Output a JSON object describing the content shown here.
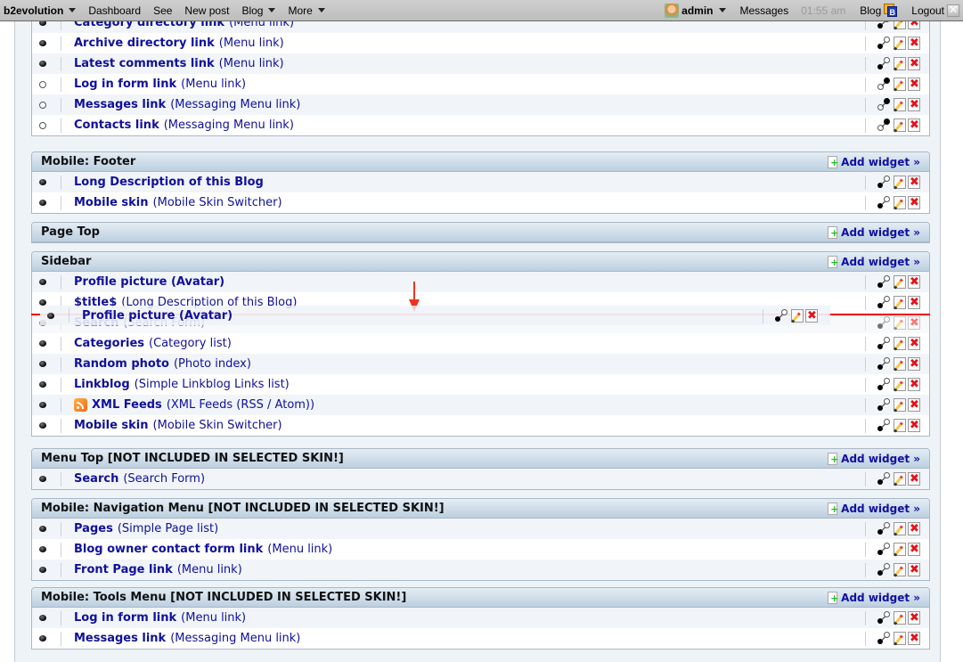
{
  "toolbar": {
    "brand": "b2evolution",
    "left_items": [
      "Dashboard",
      "See",
      "New post",
      "Blog",
      "More"
    ],
    "user": "admin",
    "messages": "Messages",
    "time": "01:55 am",
    "blog": "Blog",
    "logout": "Logout"
  },
  "add_widget_label": "Add widget »",
  "containers": [
    {
      "title": null,
      "rows": [
        {
          "name": "Category directory link",
          "type": "(Menu link)",
          "enabled": true
        },
        {
          "name": "Archive directory link",
          "type": "(Menu link)",
          "enabled": true
        },
        {
          "name": "Latest comments link",
          "type": "(Menu link)",
          "enabled": true
        },
        {
          "name": "Log in form link",
          "type": "(Menu link)",
          "enabled": false
        },
        {
          "name": "Messages link",
          "type": "(Messaging Menu link)",
          "enabled": false
        },
        {
          "name": "Contacts link",
          "type": "(Messaging Menu link)",
          "enabled": false
        }
      ]
    },
    {
      "title": "Mobile: Footer",
      "rows": [
        {
          "name": "Long Description of this Blog",
          "type": "",
          "enabled": true
        },
        {
          "name": "Mobile skin",
          "type": "(Mobile Skin Switcher)",
          "enabled": true
        }
      ]
    },
    {
      "title": "Page Top",
      "rows": []
    },
    {
      "title": "Sidebar",
      "rows": [
        {
          "name": "Profile picture (Avatar)",
          "type": "",
          "enabled": true
        },
        {
          "name": "$title$",
          "type": "(Long Description of this Blog)",
          "enabled": true
        },
        {
          "name": "Search",
          "type": "(Search Form)",
          "enabled": true
        },
        {
          "name": "Categories",
          "type": "(Category list)",
          "enabled": true
        },
        {
          "name": "Random photo",
          "type": "(Photo index)",
          "enabled": true
        },
        {
          "name": "Linkblog",
          "type": "(Simple Linkblog Links list)",
          "enabled": true
        },
        {
          "name": "XML Feeds",
          "type": "(XML Feeds (RSS / Atom))",
          "enabled": true,
          "icon": "rss-icon"
        },
        {
          "name": "Mobile skin",
          "type": "(Mobile Skin Switcher)",
          "enabled": true
        }
      ]
    },
    {
      "title": "Menu Top [NOT INCLUDED IN SELECTED SKIN!]",
      "rows": [
        {
          "name": "Search",
          "type": "(Search Form)",
          "enabled": true
        }
      ]
    },
    {
      "title": "Mobile: Navigation Menu [NOT INCLUDED IN SELECTED SKIN!]",
      "rows": [
        {
          "name": "Pages",
          "type": "(Simple Page list)",
          "enabled": true
        },
        {
          "name": "Blog owner contact form link",
          "type": "(Menu link)",
          "enabled": true
        },
        {
          "name": "Front Page link",
          "type": "(Menu link)",
          "enabled": true
        }
      ]
    },
    {
      "title": "Mobile: Tools Menu [NOT INCLUDED IN SELECTED SKIN!]",
      "rows": [
        {
          "name": "Log in form link",
          "type": "(Menu link)",
          "enabled": true
        },
        {
          "name": "Messages link",
          "type": "(Messaging Menu link)",
          "enabled": true
        }
      ]
    }
  ],
  "drag_ghost": {
    "name": "Profile picture (Avatar)",
    "enabled": true
  }
}
